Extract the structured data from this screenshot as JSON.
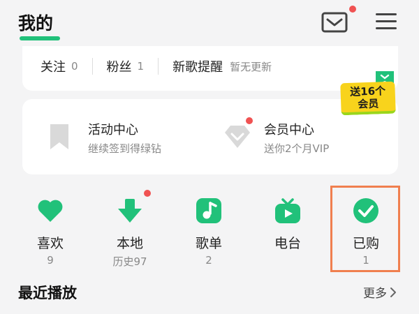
{
  "header": {
    "title": "我的",
    "accent": "#21c17a",
    "mail_icon": "mail-icon",
    "menu_icon": "menu-icon"
  },
  "social": {
    "following_label": "关注",
    "following_count": "0",
    "fans_label": "粉丝",
    "fans_count": "1",
    "new_songs_label": "新歌提醒",
    "new_songs_status": "暂无更新"
  },
  "promo": {
    "line1": "送16个",
    "line2": "会员"
  },
  "activity": {
    "items": [
      {
        "title": "活动中心",
        "subtitle": "继续签到得绿钻",
        "icon": "bookmark-icon"
      },
      {
        "title": "会员中心",
        "subtitle": "送你2个月VIP",
        "icon": "diamond-icon"
      }
    ]
  },
  "quick_access": {
    "items": [
      {
        "label": "喜欢",
        "count": "9",
        "icon": "heart-icon"
      },
      {
        "label": "本地",
        "count": "历史97",
        "icon": "download-icon"
      },
      {
        "label": "歌单",
        "count": "2",
        "icon": "music-note-icon"
      },
      {
        "label": "电台",
        "count": "",
        "icon": "radio-icon"
      },
      {
        "label": "已购",
        "count": "1",
        "icon": "check-circle-icon"
      }
    ]
  },
  "recent": {
    "title": "最近播放",
    "more_label": "更多"
  }
}
